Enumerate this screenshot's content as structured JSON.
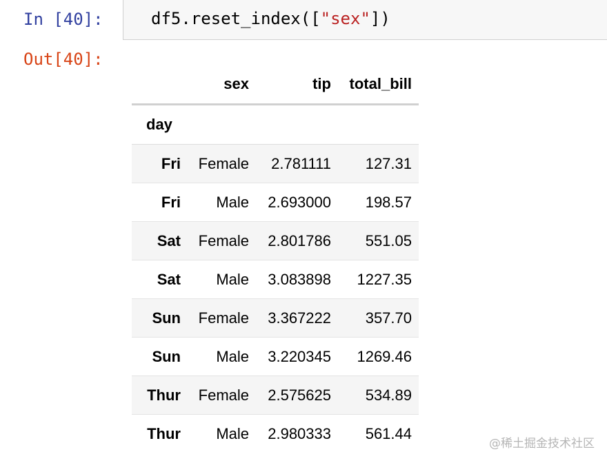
{
  "input_cell": {
    "prompt": "In [40]:",
    "code_prefix": "df5.reset_index([",
    "code_string": "\"sex\"",
    "code_suffix": "])"
  },
  "output_cell": {
    "prompt": "Out[40]:",
    "dataframe": {
      "columns": [
        "sex",
        "tip",
        "total_bill"
      ],
      "index_name": "day",
      "rows": [
        {
          "day": "Fri",
          "sex": "Female",
          "tip": "2.781111",
          "total_bill": "127.31"
        },
        {
          "day": "Fri",
          "sex": "Male",
          "tip": "2.693000",
          "total_bill": "198.57"
        },
        {
          "day": "Sat",
          "sex": "Female",
          "tip": "2.801786",
          "total_bill": "551.05"
        },
        {
          "day": "Sat",
          "sex": "Male",
          "tip": "3.083898",
          "total_bill": "1227.35"
        },
        {
          "day": "Sun",
          "sex": "Female",
          "tip": "3.367222",
          "total_bill": "357.70"
        },
        {
          "day": "Sun",
          "sex": "Male",
          "tip": "3.220345",
          "total_bill": "1269.46"
        },
        {
          "day": "Thur",
          "sex": "Female",
          "tip": "2.575625",
          "total_bill": "534.89"
        },
        {
          "day": "Thur",
          "sex": "Male",
          "tip": "2.980333",
          "total_bill": "561.44"
        }
      ]
    }
  },
  "watermark": "@稀土掘金技术社区",
  "colors": {
    "in_prompt": "#303f9f",
    "out_prompt": "#d84315",
    "string_literal": "#ba2121",
    "input_background": "#f7f7f7",
    "striped_row": "#f5f5f5"
  }
}
